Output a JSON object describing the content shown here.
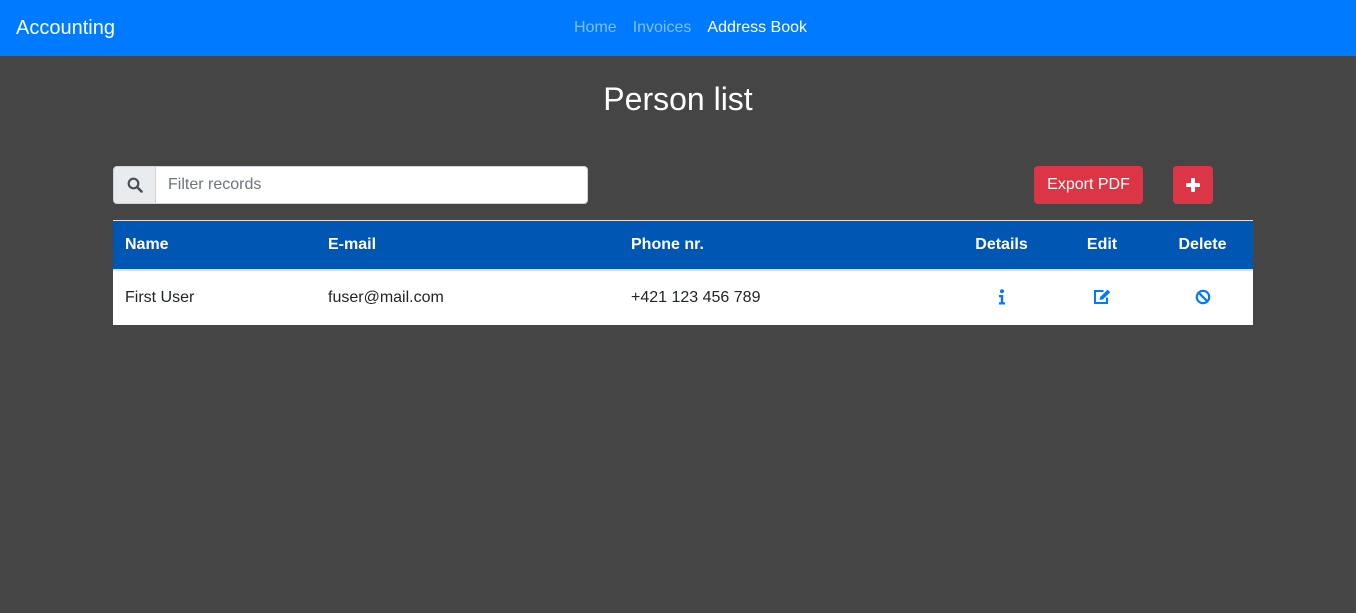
{
  "navbar": {
    "brand": "Accounting",
    "links": [
      {
        "label": "Home",
        "active": false
      },
      {
        "label": "Invoices",
        "active": false
      },
      {
        "label": "Address Book",
        "active": true
      }
    ]
  },
  "page": {
    "title": "Person list"
  },
  "search": {
    "icon": "search-icon",
    "placeholder": "Filter records",
    "value": ""
  },
  "toolbar": {
    "export_label": "Export PDF",
    "add_icon": "plus-icon",
    "button_color": "#dc3545"
  },
  "table": {
    "columns": [
      "Name",
      "E-mail",
      "Phone nr.",
      "Details",
      "Edit",
      "Delete"
    ],
    "rows": [
      {
        "name": "First User",
        "email": "fuser@mail.com",
        "phone": "+421 123 456 789",
        "details_icon": "info-icon",
        "edit_icon": "edit-icon",
        "delete_icon": "ban-icon"
      }
    ]
  },
  "colors": {
    "navbar": "#007bff",
    "table_header": "#0056b3",
    "background": "#454545",
    "icon": "#007bff"
  }
}
